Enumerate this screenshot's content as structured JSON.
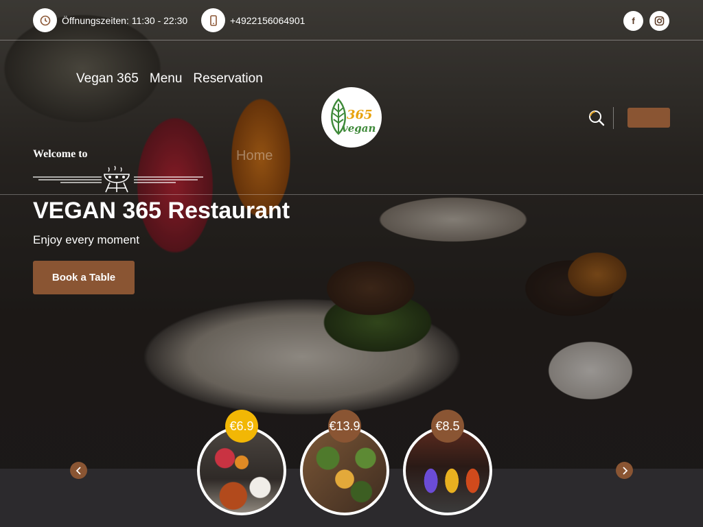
{
  "topbar": {
    "hours_icon": "clock-icon",
    "hours": "Öffnungszeiten: 11:30 - 22:30",
    "phone_icon": "phone-icon",
    "phone": "+4922156064901",
    "social": [
      {
        "name": "facebook-icon",
        "glyph": "f"
      },
      {
        "name": "instagram-icon",
        "glyph": "◎"
      }
    ]
  },
  "nav": {
    "items": [
      "Vegan 365",
      "Menu",
      "Reservation"
    ]
  },
  "logo": {
    "number": "365",
    "word": "vegan"
  },
  "breadcrumb": {
    "welcome": "Welcome to",
    "home": "Home"
  },
  "hero": {
    "title": "VEGAN 365 Restaurant",
    "subtitle": "Enjoy every moment",
    "button": "Book a Table"
  },
  "carousel": {
    "items": [
      {
        "price": "€6.9",
        "badge_color": "#f2b705"
      },
      {
        "price": "€13.9",
        "badge_color": "#8a5533"
      },
      {
        "price": "€8.5",
        "badge_color": "#8a5533"
      }
    ]
  },
  "colors": {
    "accent": "#8a5533",
    "highlight": "#f2b705",
    "logo_green": "#3f8a3a",
    "logo_orange": "#e8a20c"
  }
}
